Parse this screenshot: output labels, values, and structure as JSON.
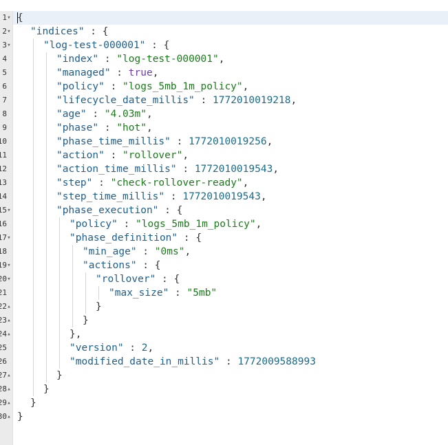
{
  "editor": {
    "lines": [
      {
        "num": "1",
        "fold": "▾",
        "indent": 0,
        "tokens": [
          [
            "p",
            "{"
          ]
        ]
      },
      {
        "num": "2",
        "fold": "▾",
        "indent": 1,
        "tokens": [
          [
            "k",
            "\"indices\""
          ],
          [
            "p",
            " : {"
          ]
        ]
      },
      {
        "num": "3",
        "fold": "▾",
        "indent": 2,
        "tokens": [
          [
            "k",
            "\"log-test-000001\""
          ],
          [
            "p",
            " : {"
          ]
        ]
      },
      {
        "num": "4",
        "fold": "",
        "indent": 3,
        "tokens": [
          [
            "k",
            "\"index\""
          ],
          [
            "p",
            " : "
          ],
          [
            "s",
            "\"log-test-000001\""
          ],
          [
            "p",
            ","
          ]
        ]
      },
      {
        "num": "5",
        "fold": "",
        "indent": 3,
        "tokens": [
          [
            "k",
            "\"managed\""
          ],
          [
            "p",
            " : "
          ],
          [
            "b",
            "true"
          ],
          [
            "p",
            ","
          ]
        ]
      },
      {
        "num": "6",
        "fold": "",
        "indent": 3,
        "tokens": [
          [
            "k",
            "\"policy\""
          ],
          [
            "p",
            " : "
          ],
          [
            "s",
            "\"logs_5mb_1m_policy\""
          ],
          [
            "p",
            ","
          ]
        ]
      },
      {
        "num": "7",
        "fold": "",
        "indent": 3,
        "tokens": [
          [
            "k",
            "\"lifecycle_date_millis\""
          ],
          [
            "p",
            " : "
          ],
          [
            "n",
            "1772010019218"
          ],
          [
            "p",
            ","
          ]
        ]
      },
      {
        "num": "8",
        "fold": "",
        "indent": 3,
        "tokens": [
          [
            "k",
            "\"age\""
          ],
          [
            "p",
            " : "
          ],
          [
            "s",
            "\"4.03m\""
          ],
          [
            "p",
            ","
          ]
        ]
      },
      {
        "num": "9",
        "fold": "",
        "indent": 3,
        "tokens": [
          [
            "k",
            "\"phase\""
          ],
          [
            "p",
            " : "
          ],
          [
            "s",
            "\"hot\""
          ],
          [
            "p",
            ","
          ]
        ]
      },
      {
        "num": "10",
        "fold": "",
        "indent": 3,
        "tokens": [
          [
            "k",
            "\"phase_time_millis\""
          ],
          [
            "p",
            " : "
          ],
          [
            "n",
            "1772010019256"
          ],
          [
            "p",
            ","
          ]
        ]
      },
      {
        "num": "11",
        "fold": "",
        "indent": 3,
        "tokens": [
          [
            "k",
            "\"action\""
          ],
          [
            "p",
            " : "
          ],
          [
            "s",
            "\"rollover\""
          ],
          [
            "p",
            ","
          ]
        ]
      },
      {
        "num": "12",
        "fold": "",
        "indent": 3,
        "tokens": [
          [
            "k",
            "\"action_time_millis\""
          ],
          [
            "p",
            " : "
          ],
          [
            "n",
            "1772010019543"
          ],
          [
            "p",
            ","
          ]
        ]
      },
      {
        "num": "13",
        "fold": "",
        "indent": 3,
        "tokens": [
          [
            "k",
            "\"step\""
          ],
          [
            "p",
            " : "
          ],
          [
            "s",
            "\"check-rollover-ready\""
          ],
          [
            "p",
            ","
          ]
        ]
      },
      {
        "num": "14",
        "fold": "",
        "indent": 3,
        "tokens": [
          [
            "k",
            "\"step_time_millis\""
          ],
          [
            "p",
            " : "
          ],
          [
            "n",
            "1772010019543"
          ],
          [
            "p",
            ","
          ]
        ]
      },
      {
        "num": "15",
        "fold": "▾",
        "indent": 3,
        "tokens": [
          [
            "k",
            "\"phase_execution\""
          ],
          [
            "p",
            " : {"
          ]
        ]
      },
      {
        "num": "16",
        "fold": "",
        "indent": 4,
        "tokens": [
          [
            "k",
            "\"policy\""
          ],
          [
            "p",
            " : "
          ],
          [
            "s",
            "\"logs_5mb_1m_policy\""
          ],
          [
            "p",
            ","
          ]
        ]
      },
      {
        "num": "17",
        "fold": "▾",
        "indent": 4,
        "tokens": [
          [
            "k",
            "\"phase_definition\""
          ],
          [
            "p",
            " : {"
          ]
        ]
      },
      {
        "num": "18",
        "fold": "",
        "indent": 5,
        "tokens": [
          [
            "k",
            "\"min_age\""
          ],
          [
            "p",
            " : "
          ],
          [
            "s",
            "\"0ms\""
          ],
          [
            "p",
            ","
          ]
        ]
      },
      {
        "num": "19",
        "fold": "▾",
        "indent": 5,
        "tokens": [
          [
            "k",
            "\"actions\""
          ],
          [
            "p",
            " : {"
          ]
        ]
      },
      {
        "num": "20",
        "fold": "▾",
        "indent": 6,
        "tokens": [
          [
            "k",
            "\"rollover\""
          ],
          [
            "p",
            " : {"
          ]
        ]
      },
      {
        "num": "21",
        "fold": "",
        "indent": 7,
        "tokens": [
          [
            "k",
            "\"max_size\""
          ],
          [
            "p",
            " : "
          ],
          [
            "s",
            "\"5mb\""
          ]
        ]
      },
      {
        "num": "22",
        "fold": "▴",
        "indent": 6,
        "tokens": [
          [
            "p",
            "}"
          ]
        ]
      },
      {
        "num": "23",
        "fold": "▴",
        "indent": 5,
        "tokens": [
          [
            "p",
            "}"
          ]
        ]
      },
      {
        "num": "24",
        "fold": "▴",
        "indent": 4,
        "tokens": [
          [
            "p",
            "},"
          ]
        ]
      },
      {
        "num": "25",
        "fold": "",
        "indent": 4,
        "tokens": [
          [
            "k",
            "\"version\""
          ],
          [
            "p",
            " : "
          ],
          [
            "n",
            "2"
          ],
          [
            "p",
            ","
          ]
        ]
      },
      {
        "num": "26",
        "fold": "",
        "indent": 4,
        "tokens": [
          [
            "k",
            "\"modified_date_in_millis\""
          ],
          [
            "p",
            " : "
          ],
          [
            "n",
            "1772009588993"
          ]
        ]
      },
      {
        "num": "27",
        "fold": "▴",
        "indent": 3,
        "tokens": [
          [
            "p",
            "}"
          ]
        ]
      },
      {
        "num": "28",
        "fold": "▴",
        "indent": 2,
        "tokens": [
          [
            "p",
            "}"
          ]
        ]
      },
      {
        "num": "29",
        "fold": "▴",
        "indent": 1,
        "tokens": [
          [
            "p",
            "}"
          ]
        ]
      },
      {
        "num": "30",
        "fold": "▴",
        "indent": 0,
        "tokens": [
          [
            "p",
            "}"
          ]
        ]
      }
    ]
  },
  "colors": {
    "key": "#1d5e8c",
    "string": "#1a7a1a",
    "number": "#1a6b8a",
    "boolean": "#6b3fa8",
    "gutter_bg": "#ebebeb",
    "active_line": "#eaf0f7"
  }
}
